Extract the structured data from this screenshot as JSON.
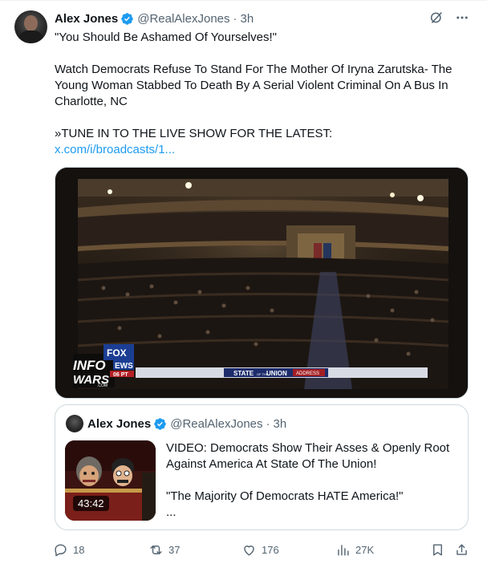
{
  "post": {
    "author": "Alex Jones",
    "handle": "@RealAlexJones",
    "time": "3h",
    "lines": [
      "\"You Should Be Ashamed Of Yourselves!\"",
      "Watch Democrats Refuse To Stand For The Mother Of Iryna Zarutska- The Young Woman Stabbed To Death By A Serial Violent Criminal On A Bus In Charlotte, NC",
      "»TUNE IN TO THE LIVE SHOW FOR THE LATEST:"
    ],
    "link": "x.com/i/broadcasts/1...",
    "media": {
      "logo_fox": "FOX",
      "logo_news": "EWS",
      "logo_info": "INFO",
      "logo_wars": "WARS",
      "logo_time": "06 PT",
      "logo_com": ".COM",
      "banner_left": "STATE",
      "banner_of_the": "OF THE",
      "banner_union": "UNION",
      "banner_address": "ADDRESS"
    }
  },
  "quoted": {
    "author": "Alex Jones",
    "handle": "@RealAlexJones",
    "time": "3h",
    "duration": "43:42",
    "lines": [
      "VIDEO: Democrats Show Their Asses & Openly Root Against America At State Of The Union!",
      "\"The Majority Of Democrats HATE America!\"",
      "..."
    ]
  },
  "actions": {
    "replies": "18",
    "reposts": "37",
    "likes": "176",
    "views": "27K"
  },
  "icons": {
    "verified": "verified-badge-icon",
    "grok": "grok-icon",
    "more": "more-icon",
    "reply": "reply-icon",
    "repost": "repost-icon",
    "like": "heart-icon",
    "views": "views-icon",
    "bookmark": "bookmark-icon",
    "share": "share-icon"
  },
  "colors": {
    "accent": "#1d9bf0",
    "text": "#0f1419",
    "muted": "#536471"
  }
}
